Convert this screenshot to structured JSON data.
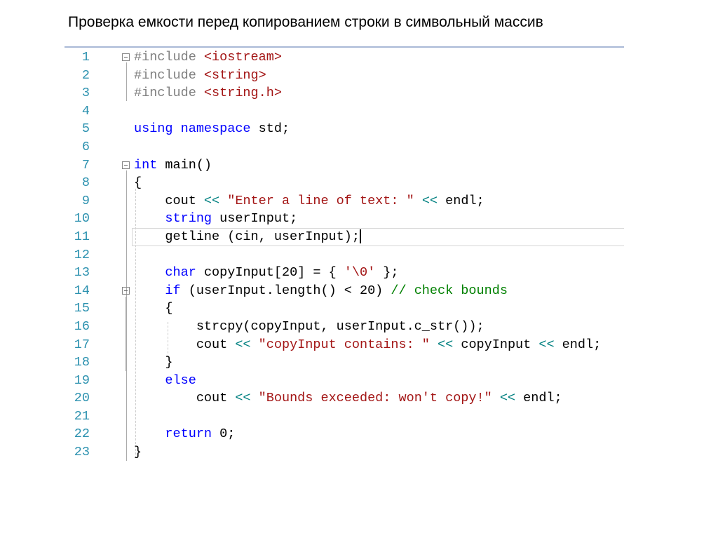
{
  "title": "Проверка емкости перед копированием строки в символьный массив",
  "colors": {
    "keyword": "#0000ff",
    "string": "#a31515",
    "comment": "#008000",
    "operator": "#008080",
    "preprocessor": "#808080",
    "line_number": "#2b91af"
  },
  "cursor_line": 11,
  "lines": [
    {
      "n": "1",
      "fold": true,
      "t": [
        [
          "#include ",
          "pp"
        ],
        [
          "<iostream>",
          "str"
        ]
      ]
    },
    {
      "n": "2",
      "t": [
        [
          "#include ",
          "pp"
        ],
        [
          "<string>",
          "str"
        ]
      ]
    },
    {
      "n": "3",
      "t": [
        [
          "#include ",
          "pp"
        ],
        [
          "<string.h>",
          "str"
        ]
      ]
    },
    {
      "n": "4",
      "t": []
    },
    {
      "n": "5",
      "t": [
        [
          "using namespace",
          "kw"
        ],
        [
          " std;",
          "tx"
        ]
      ]
    },
    {
      "n": "6",
      "t": []
    },
    {
      "n": "7",
      "fold": true,
      "t": [
        [
          "int",
          "kw"
        ],
        [
          " main()",
          "tx"
        ]
      ]
    },
    {
      "n": "8",
      "t": [
        [
          "{",
          "tx"
        ]
      ]
    },
    {
      "n": "9",
      "t": [
        [
          "    cout ",
          "tx"
        ],
        [
          "<<",
          "op"
        ],
        [
          " ",
          "tx"
        ],
        [
          "\"Enter a line of text: \"",
          "str"
        ],
        [
          " ",
          "tx"
        ],
        [
          "<<",
          "op"
        ],
        [
          " endl;",
          "tx"
        ]
      ]
    },
    {
      "n": "10",
      "t": [
        [
          "    ",
          "tx"
        ],
        [
          "string",
          "kw"
        ],
        [
          " userInput;",
          "tx"
        ]
      ]
    },
    {
      "n": "11",
      "t": [
        [
          "    getline (cin, userInput);",
          "tx"
        ]
      ]
    },
    {
      "n": "12",
      "t": []
    },
    {
      "n": "13",
      "t": [
        [
          "    ",
          "tx"
        ],
        [
          "char",
          "kw"
        ],
        [
          " copyInput[20] = { ",
          "tx"
        ],
        [
          "'\\0'",
          "str"
        ],
        [
          " };",
          "tx"
        ]
      ]
    },
    {
      "n": "14",
      "fold": true,
      "t": [
        [
          "    ",
          "tx"
        ],
        [
          "if",
          "kw"
        ],
        [
          " (userInput.length() < 20) ",
          "tx"
        ],
        [
          "// check bounds",
          "com"
        ]
      ]
    },
    {
      "n": "15",
      "t": [
        [
          "    {",
          "tx"
        ]
      ]
    },
    {
      "n": "16",
      "t": [
        [
          "        strcpy(copyInput, userInput.c_str());",
          "tx"
        ]
      ]
    },
    {
      "n": "17",
      "t": [
        [
          "        cout ",
          "tx"
        ],
        [
          "<<",
          "op"
        ],
        [
          " ",
          "tx"
        ],
        [
          "\"copyInput contains: \"",
          "str"
        ],
        [
          " ",
          "tx"
        ],
        [
          "<<",
          "op"
        ],
        [
          " copyInput ",
          "tx"
        ],
        [
          "<<",
          "op"
        ],
        [
          " endl;",
          "tx"
        ]
      ]
    },
    {
      "n": "18",
      "t": [
        [
          "    }",
          "tx"
        ]
      ]
    },
    {
      "n": "19",
      "t": [
        [
          "    ",
          "tx"
        ],
        [
          "else",
          "kw"
        ]
      ]
    },
    {
      "n": "20",
      "t": [
        [
          "        cout ",
          "tx"
        ],
        [
          "<<",
          "op"
        ],
        [
          " ",
          "tx"
        ],
        [
          "\"Bounds exceeded: won't copy!\"",
          "str"
        ],
        [
          " ",
          "tx"
        ],
        [
          "<<",
          "op"
        ],
        [
          " endl;",
          "tx"
        ]
      ]
    },
    {
      "n": "21",
      "t": []
    },
    {
      "n": "22",
      "t": [
        [
          "    ",
          "tx"
        ],
        [
          "return",
          "kw"
        ],
        [
          " 0;",
          "tx"
        ]
      ]
    },
    {
      "n": "23",
      "t": [
        [
          "}",
          "tx"
        ]
      ]
    }
  ]
}
